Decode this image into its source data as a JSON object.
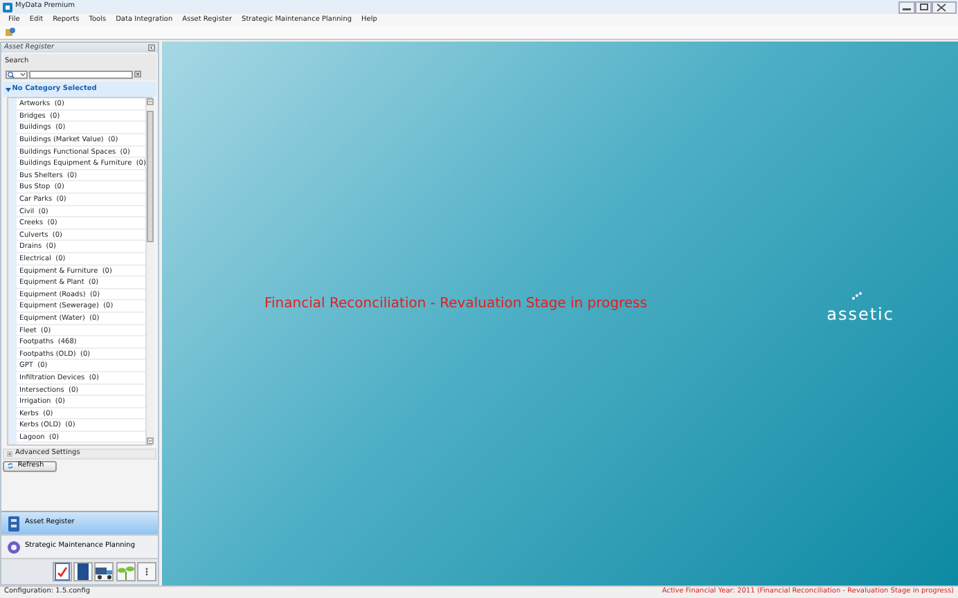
{
  "window": {
    "title": "MyData Premium"
  },
  "menu": [
    "File",
    "Edit",
    "Reports",
    "Tools",
    "Data Integration",
    "Asset Register",
    "Strategic Maintenance Planning",
    "Help"
  ],
  "panel": {
    "title": "Asset Register",
    "search_label": "Search",
    "category_header": "No Category Selected",
    "categories": [
      "Artworks  (0)",
      "Bridges  (0)",
      "Buildings  (0)",
      "Buildings (Market Value)  (0)",
      "Buildings Functional Spaces  (0)",
      "Buildings Equipment & Furniture  (0)",
      "Bus Shelters  (0)",
      "Bus Stop  (0)",
      "Car Parks  (0)",
      "Civil  (0)",
      "Creeks  (0)",
      "Culverts  (0)",
      "Drains  (0)",
      "Electrical  (0)",
      "Equipment & Furniture  (0)",
      "Equipment & Plant  (0)",
      "Equipment (Roads)  (0)",
      "Equipment (Sewerage)  (0)",
      "Equipment (Water)  (0)",
      "Fleet  (0)",
      "Footpaths  (468)",
      "Footpaths (OLD)  (0)",
      "GPT  (0)",
      "Infiltration Devices  (0)",
      "Intersections  (0)",
      "Irrigation  (0)",
      "Kerbs  (0)",
      "Kerbs (OLD)  (0)",
      "Lagoon  (0)"
    ],
    "advanced": "Advanced Settings",
    "refresh": "Refresh"
  },
  "nav": [
    {
      "label": "Asset Register",
      "selected": true
    },
    {
      "label": "Strategic Maintenance Planning",
      "selected": false
    }
  ],
  "main": {
    "message": "Financial Reconciliation - Revaluation Stage in progress",
    "logo": "assetic"
  },
  "status_bar": {
    "left": "Configuration: 1.5.config",
    "right": "Active Financial Year: 2011 (Financial Reconciliation - Revaluation Stage in progress)"
  }
}
